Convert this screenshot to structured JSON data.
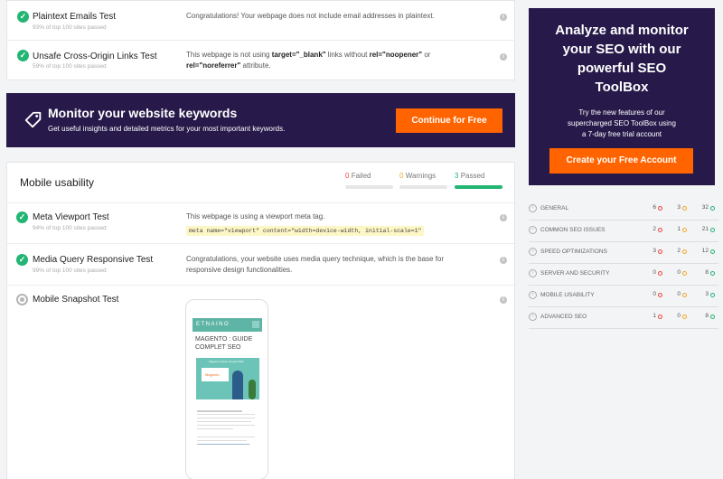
{
  "top_tests": [
    {
      "name": "Plaintext Emails Test",
      "sub": "93% of top 100 sites passed",
      "desc": "Congratulations! Your webpage does not include email addresses in plaintext."
    },
    {
      "name": "Unsafe Cross-Origin Links Test",
      "sub": "59% of top 100 sites passed",
      "desc_pre": "This webpage is not using ",
      "desc_b1": "target=\"_blank\"",
      "desc_mid": " links without ",
      "desc_b2": "rel=\"noopener\"",
      "desc_or": " or",
      "desc_b3": "rel=\"noreferrer\"",
      "desc_end": " attribute."
    }
  ],
  "banner": {
    "title": "Monitor your website keywords",
    "subtitle": "Get useful insights and detailed metrics for your most important keywords.",
    "button": "Continue for Free"
  },
  "mobile": {
    "title": "Mobile usability",
    "failed": {
      "count": "0",
      "label": "Failed"
    },
    "warnings": {
      "count": "0",
      "label": "Warnings"
    },
    "passed": {
      "count": "3",
      "label": "Passed"
    },
    "tests": [
      {
        "name": "Meta Viewport Test",
        "sub": "94% of top 100 sites passed",
        "desc": "This webpage is using a viewport meta tag.",
        "code": "meta name=\"viewport\" content=\"width=device-width, initial-scale=1\""
      },
      {
        "name": "Media Query Responsive Test",
        "sub": "99% of top 100 sites passed",
        "desc1": "Congratulations, your website uses media query technique, which is the base for",
        "desc2": "responsive design functionalities."
      },
      {
        "name": "Mobile Snapshot Test"
      }
    ],
    "snapshot": {
      "brand": "ETNAINO",
      "heading1": "MAGENTO : GUIDE",
      "heading2": "COMPLET SEO",
      "card_label": "Magento Guide complet SEO",
      "badge": "Magento"
    }
  },
  "promo": {
    "title_lines": [
      "Analyze and monitor",
      "your SEO with our",
      "powerful SEO",
      "ToolBox"
    ],
    "body_lines": [
      "Try the new features of our",
      "supercharged SEO ToolBox using",
      "a 7-day free trial account"
    ],
    "button": "Create your Free Account"
  },
  "summary": [
    {
      "label": "GENERAL",
      "red": "6",
      "orange": "3",
      "green": "32"
    },
    {
      "label": "COMMON SEO ISSUES",
      "red": "2",
      "orange": "1",
      "green": "21"
    },
    {
      "label": "SPEED OPTIMIZATIONS",
      "red": "3",
      "orange": "2",
      "green": "12"
    },
    {
      "label": "SERVER AND SECURITY",
      "red": "0",
      "orange": "0",
      "green": "8"
    },
    {
      "label": "MOBILE USABILITY",
      "red": "0",
      "orange": "0",
      "green": "3"
    },
    {
      "label": "ADVANCED SEO",
      "red": "1",
      "orange": "0",
      "green": "8"
    }
  ],
  "colors": {
    "brand_dark": "#271a4a",
    "accent_orange": "#ff6400",
    "pass_green": "#22b573",
    "fail_red": "#f1453d",
    "warn_orange": "#f5a623"
  },
  "icons": {
    "pass": "check-icon",
    "info": "info-icon",
    "tag": "tag-icon",
    "category": "chevron-circle-icon"
  }
}
